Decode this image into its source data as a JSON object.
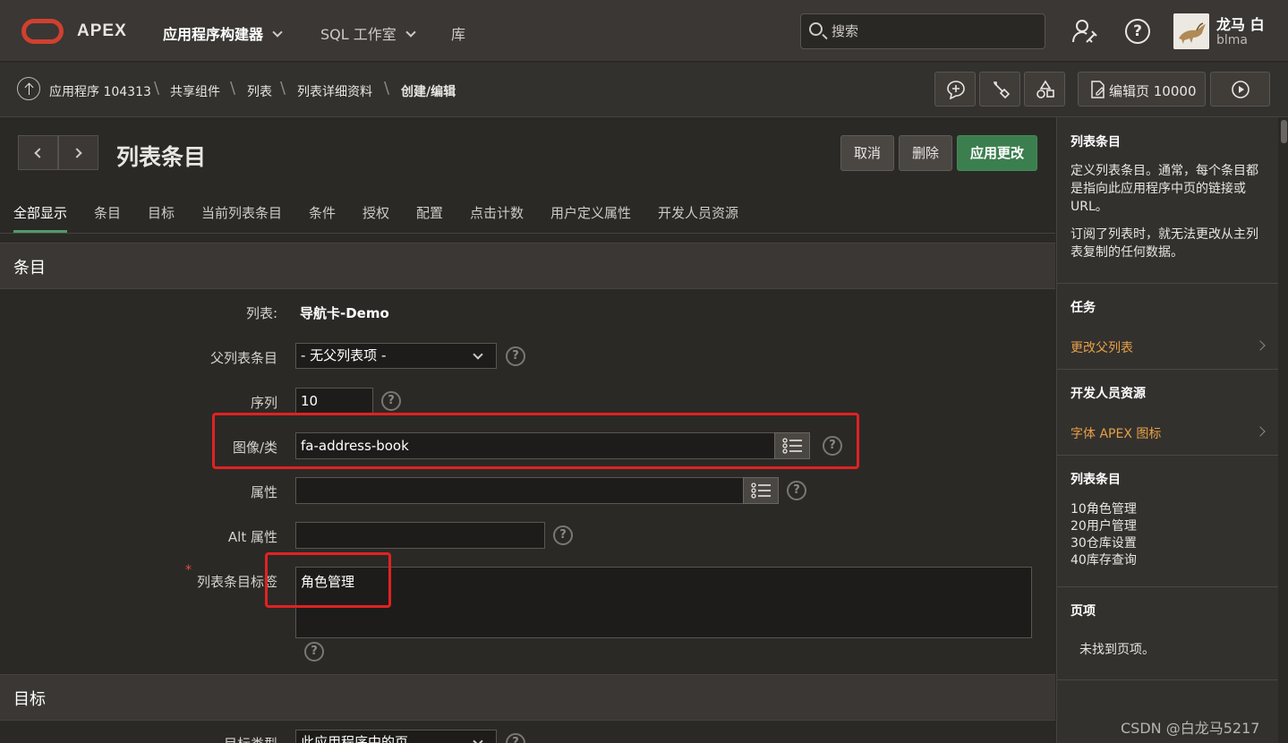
{
  "topbar": {
    "brand": "APEX",
    "nav": [
      {
        "label": "应用程序构建器"
      },
      {
        "label": "SQL 工作室"
      },
      {
        "label": "库"
      }
    ],
    "search_placeholder": "搜索",
    "user_name": "龙马 白",
    "user_login": "blma"
  },
  "breadcrumb": {
    "items": [
      "应用程序 104313",
      "共享组件",
      "列表",
      "列表详细资料",
      "创建/编辑"
    ],
    "edit_page_label": "编辑页 10000"
  },
  "page": {
    "title": "列表条目",
    "buttons": {
      "cancel": "取消",
      "delete": "删除",
      "apply": "应用更改"
    }
  },
  "tabs": [
    "全部显示",
    "条目",
    "目标",
    "当前列表条目",
    "条件",
    "授权",
    "配置",
    "点击计数",
    "用户定义属性",
    "开发人员资源"
  ],
  "sections": {
    "entry": "条目",
    "target": "目标"
  },
  "form": {
    "list_label": "列表:",
    "list_value": "导航卡-Demo",
    "parent_label": "父列表条目",
    "parent_value": "- 无父列表项 -",
    "sequence_label": "序列",
    "sequence_value": "10",
    "image_label": "图像/类",
    "image_value": "fa-address-book",
    "attr_label": "属性",
    "attr_value": "",
    "alt_label": "Alt 属性",
    "alt_value": "",
    "entry_label": "列表条目标签",
    "entry_value": "角色管理",
    "target_type_label": "目标类型",
    "target_type_value": "此应用程序中的页"
  },
  "sidebar": {
    "sec1_title": "列表条目",
    "sec1_text1": "定义列表条目。通常，每个条目都是指向此应用程序中页的链接或 URL。",
    "sec1_text2": "订阅了列表时，就无法更改从主列表复制的任何数据。",
    "tasks_title": "任务",
    "tasks_link": "更改父列表",
    "dev_title": "开发人员资源",
    "dev_link": "字体 APEX 图标",
    "entries_title": "列表条目",
    "entries": [
      "10角色管理",
      "20用户管理",
      "30仓库设置",
      "40库存查询"
    ],
    "pages_title": "页项",
    "pages_empty": "未找到页项。"
  },
  "watermark": "CSDN @白龙马5217",
  "colors": {
    "accent_green": "#3b7f4e",
    "link_orange": "#e8a047",
    "highlight_red": "#e02222",
    "brand_red": "#d0402f"
  }
}
